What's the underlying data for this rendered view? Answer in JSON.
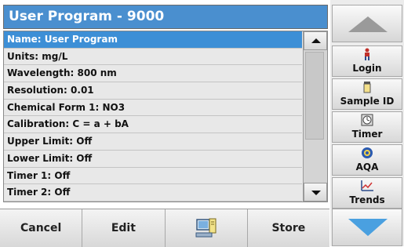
{
  "title": "User Program - 9000",
  "list": {
    "items": [
      "Name: User Program",
      "Units: mg/L",
      "Wavelength: 800 nm",
      "Resolution: 0.01",
      "Chemical Form 1: NO3",
      "Calibration: C = a + bA",
      "Upper Limit: Off",
      "Lower Limit: Off",
      "Timer 1: Off",
      "Timer 2: Off"
    ],
    "selected_index": 0
  },
  "bottom": {
    "cancel": "Cancel",
    "edit": "Edit",
    "computer_icon": "computer-icon",
    "store": "Store"
  },
  "side": {
    "scroll_up_icon": "arrow-up-icon",
    "scroll_down_icon": "arrow-down-icon",
    "buttons": [
      {
        "label": "Login",
        "icon": "person-icon"
      },
      {
        "label": "Sample ID",
        "icon": "sample-vial-icon"
      },
      {
        "label": "Timer",
        "icon": "timer-icon"
      },
      {
        "label": "AQA",
        "icon": "aqa-icon"
      },
      {
        "label": "Trends",
        "icon": "trend-chart-icon"
      }
    ]
  },
  "colors": {
    "title_bg": "#4a8fcf",
    "selected_row": "#3d8fd6",
    "down_arrow": "#4aa0e0"
  }
}
